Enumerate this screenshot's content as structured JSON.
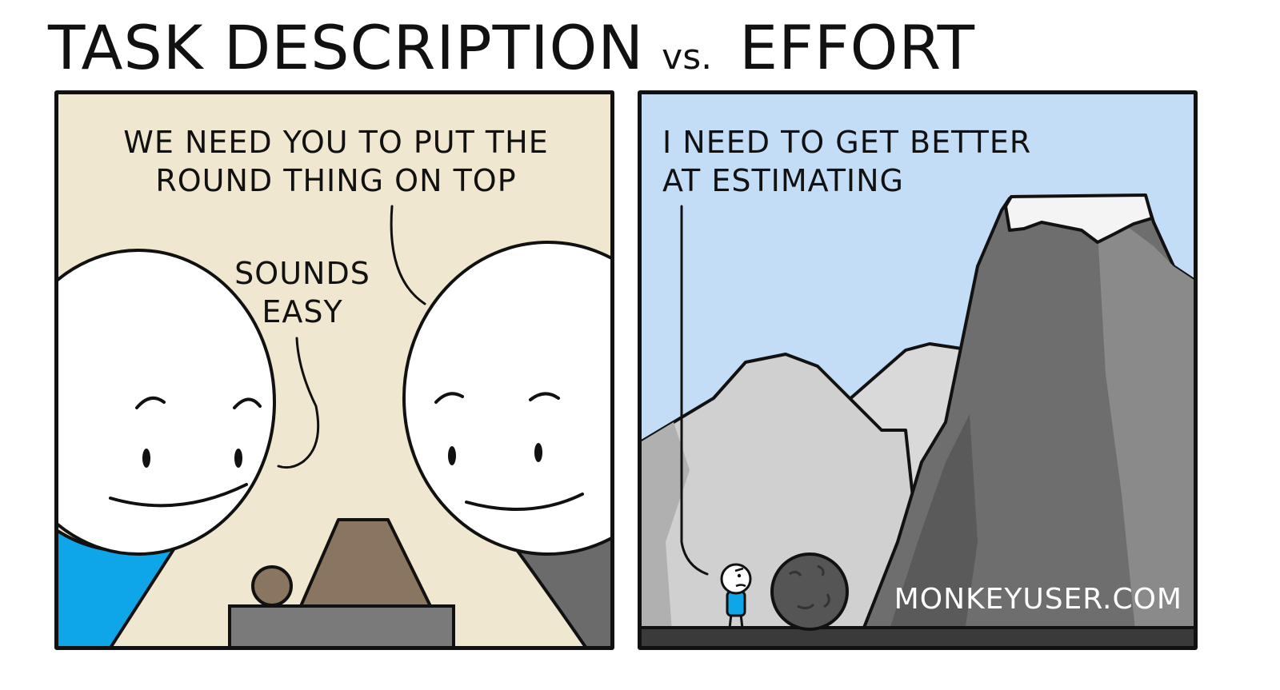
{
  "comic": {
    "title_part1": "TASK DESCRIPTION",
    "title_vs": "vs.",
    "title_part2": "EFFORT",
    "left_panel": {
      "speech_boss": "WE NEED YOU TO PUT THE\nROUND THING ON TOP",
      "speech_dev": "SOUNDS\nEASY"
    },
    "right_panel": {
      "speech_dev": "I NEED TO GET BETTER\nAT ESTIMATING",
      "watermark": "MONKEYUSER.COM"
    }
  },
  "colors": {
    "left_background": "#efe7d0",
    "right_background": "#c4ddf6",
    "dev_shirt": "#0ea5e9",
    "boss_shirt": "#6b6b6b",
    "pebble": "#8a7560",
    "light_mountain": "#d4d4d4",
    "dark_mountain": "#6e6e6e",
    "snow": "#f2f2f2"
  }
}
